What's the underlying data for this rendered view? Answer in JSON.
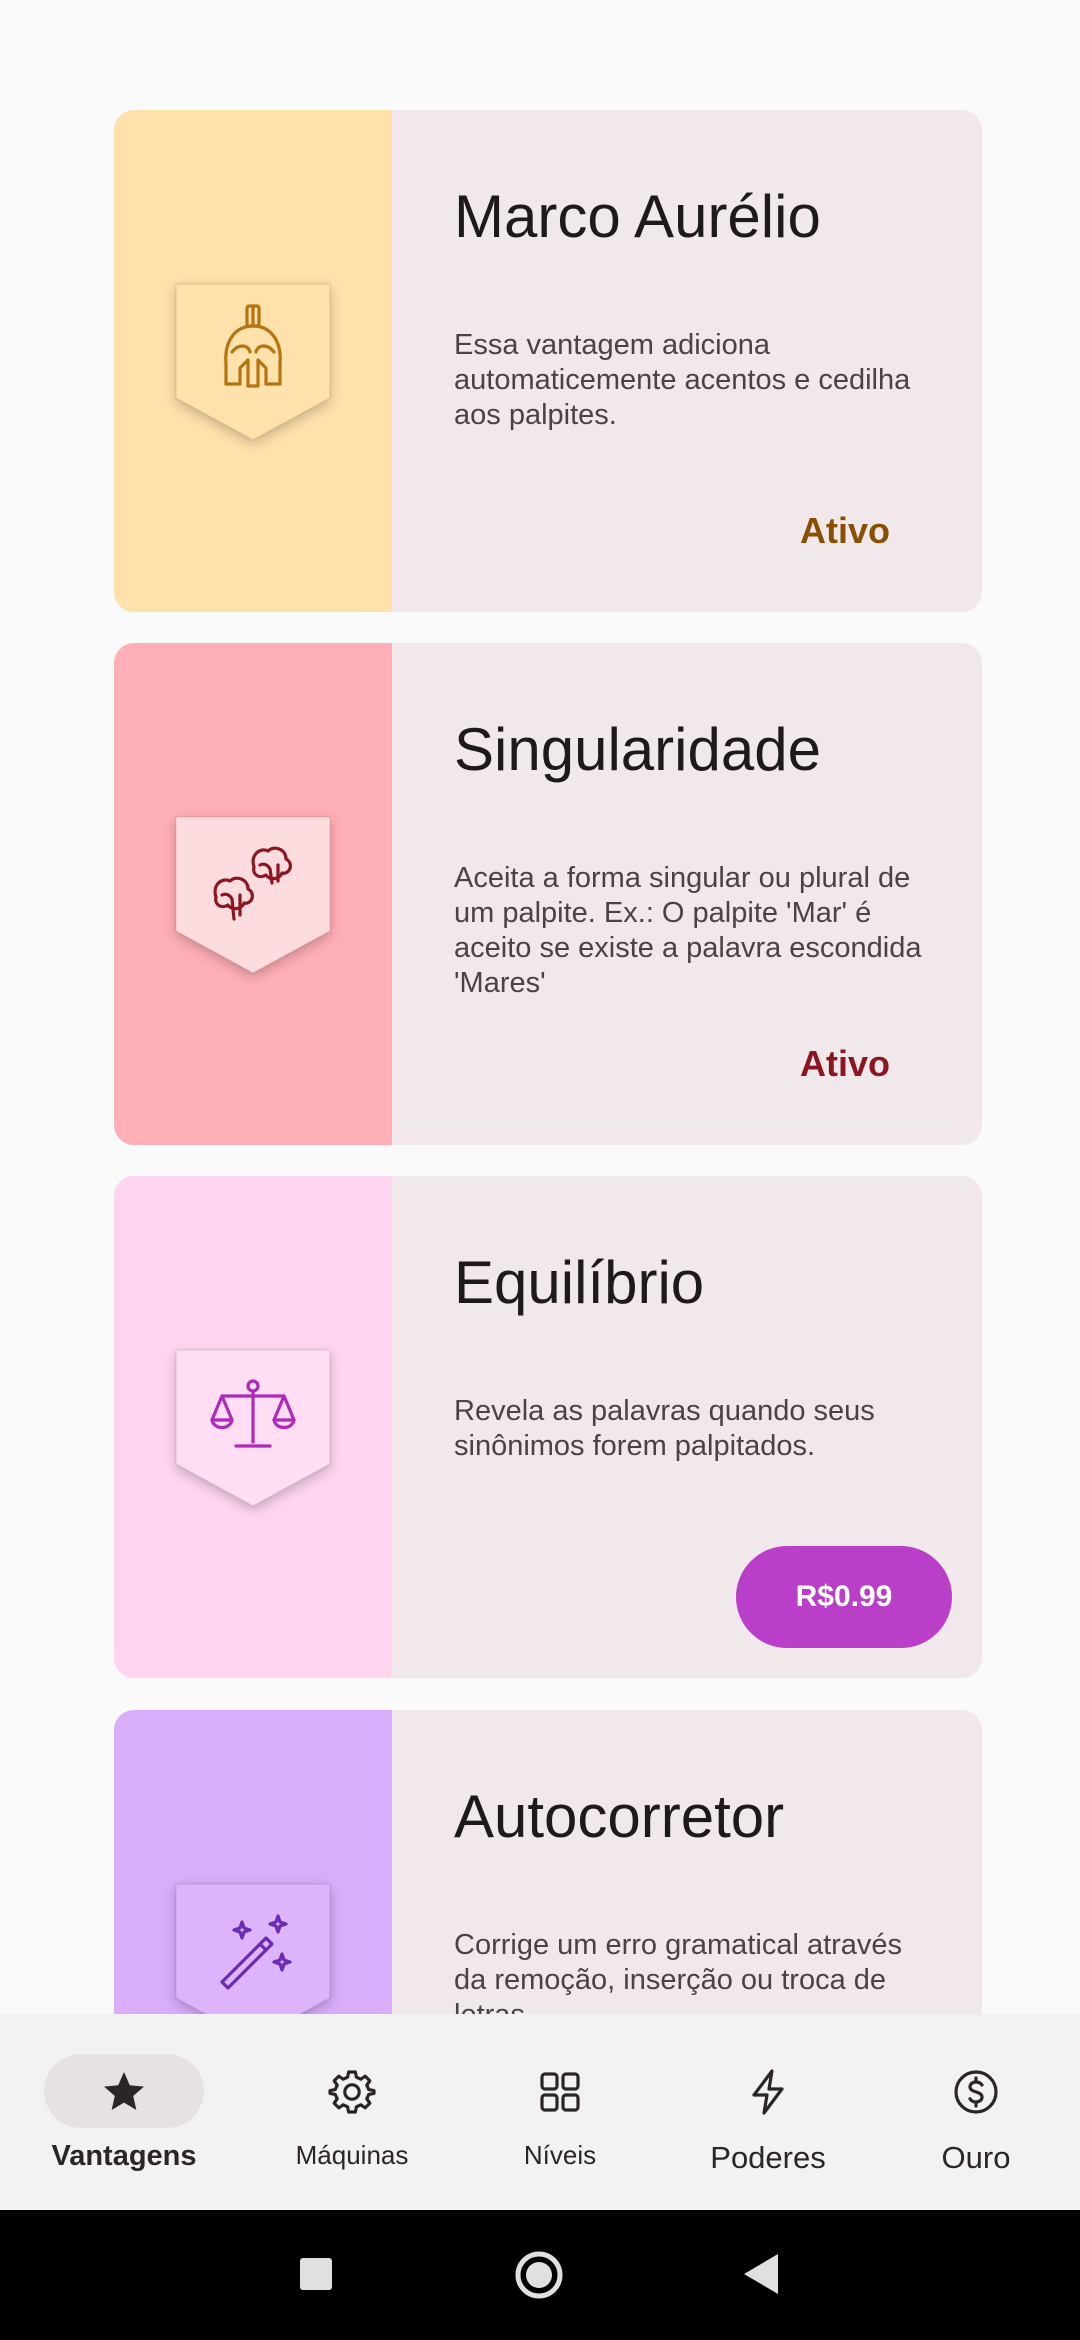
{
  "cards": [
    {
      "title": "Marco Aurélio",
      "description": "Essa vantagem adiciona automaticemente acentos e cedilha aos palpites.",
      "status": "Ativo",
      "icon": "spartan-helmet-icon",
      "side_color": "#FFE1AC",
      "badge_color": "#FFE1AC",
      "icon_color": "#B5740F",
      "status_color": "#8A4E00"
    },
    {
      "title": "Singularidade",
      "description": "Aceita a forma singular ou plural de um palpite. Ex.: O palpite 'Mar' é aceito se existe a palavra escondida 'Mares'",
      "status": "Ativo",
      "icon": "two-sheep-icon",
      "side_color": "#FFAFB5",
      "badge_color": "#FDDCDF",
      "icon_color": "#8B1520",
      "status_color": "#8B1520"
    },
    {
      "title": "Equilíbrio",
      "description": "Revela as palavras quando seus sinônimos forem palpitados.",
      "price": "R$0.99",
      "icon": "balance-scale-icon",
      "side_color": "#FFD5F0",
      "badge_color": "#FFDDF3",
      "icon_color": "#B02AB8",
      "button_color": "#BA3FC8"
    },
    {
      "title": "Autocorretor",
      "description": "Corrige um erro gramatical através da remoção, inserção ou troca de letras.",
      "icon": "magic-wand-icon",
      "side_color": "#D8AEFB",
      "badge_color": "#DDB3FC",
      "icon_color": "#6A2BB0"
    }
  ],
  "bottom_nav": {
    "items": [
      {
        "label": "Vantagens",
        "icon": "star-icon",
        "active": true
      },
      {
        "label": "Máquinas",
        "icon": "gear-icon",
        "active": false
      },
      {
        "label": "Níveis",
        "icon": "grid-icon",
        "active": false
      },
      {
        "label": "Poderes",
        "icon": "lightning-icon",
        "active": false
      },
      {
        "label": "Ouro",
        "icon": "dollar-coin-icon",
        "active": false
      }
    ],
    "active_pill_color": "#E6E2E4"
  },
  "system_nav": {
    "buttons": [
      "recents-button",
      "home-button",
      "back-button"
    ]
  }
}
